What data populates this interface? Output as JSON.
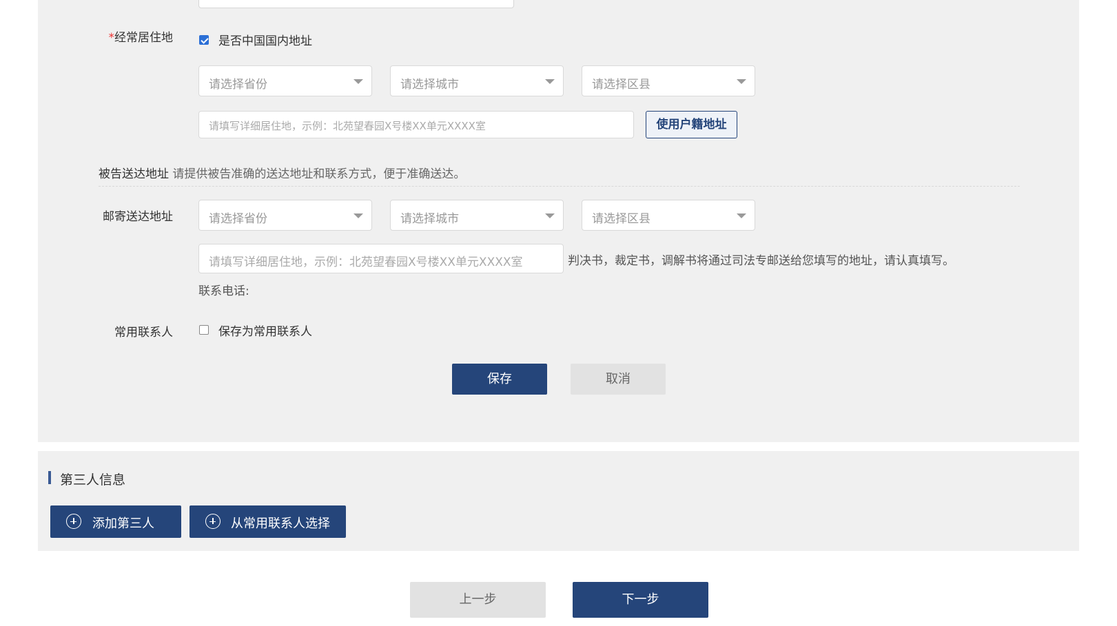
{
  "residence": {
    "label_required_mark": "*",
    "label": "经常居住地",
    "domestic_checkbox_label": "是否中国国内地址",
    "domestic_checked": true,
    "province_placeholder": "请选择省份",
    "city_placeholder": "请选择城市",
    "district_placeholder": "请选择区县",
    "detail_placeholder": "请填写详细居住地，示例：北苑望春园X号楼XX单元XXXX室",
    "use_household_button": "使用户籍地址"
  },
  "defendant_address": {
    "title": "被告送达地址",
    "note": "请提供被告准确的送达地址和联系方式，便于准确送达。",
    "mail_label": "邮寄送达地址",
    "province_placeholder": "请选择省份",
    "city_placeholder": "请选择城市",
    "district_placeholder": "请选择区县",
    "detail_placeholder": "请填写详细居住地，示例：北苑望春园X号楼XX单元XXXX室",
    "detail_hint": "判决书，裁定书，调解书将通过司法专邮送给您填写的地址，请认真填写。",
    "phone_label": "联系电话:"
  },
  "contact": {
    "label": "常用联系人",
    "save_checkbox_label": "保存为常用联系人",
    "save_checked": false
  },
  "form_actions": {
    "save": "保存",
    "cancel": "取消"
  },
  "third_party": {
    "title": "第三人信息",
    "add_button": "添加第三人",
    "select_button": "从常用联系人选择"
  },
  "wizard": {
    "prev": "上一步",
    "next": "下一步"
  },
  "colors": {
    "primary": "#25457a",
    "panel_bg": "#f0f0f0",
    "checkbox": "#2b6fd6",
    "required": "#ee3333"
  }
}
